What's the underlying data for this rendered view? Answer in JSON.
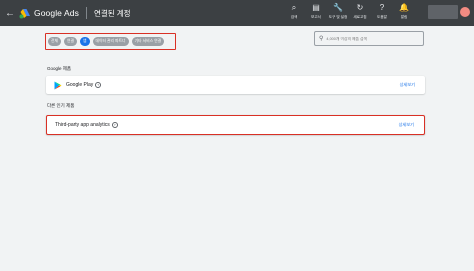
{
  "header": {
    "app_name": "Google Ads",
    "page_title": "연결된 계정",
    "tools": [
      {
        "icon": "search-icon",
        "glyph": "⌕",
        "label": "검색"
      },
      {
        "icon": "report-icon",
        "glyph": "▤",
        "label": "보고서"
      },
      {
        "icon": "wrench-icon",
        "glyph": "🔧",
        "label": "도구 및 설정"
      },
      {
        "icon": "refresh-icon",
        "glyph": "↻",
        "label": "새로고침"
      },
      {
        "icon": "help-icon",
        "glyph": "?",
        "label": "도움말"
      },
      {
        "icon": "bell-icon",
        "glyph": "🔔",
        "label": "알림"
      }
    ]
  },
  "filters": {
    "chips": [
      {
        "label": "전체",
        "active": false
      },
      {
        "label": "연결",
        "active": false
      },
      {
        "label": "앱",
        "active": true
      },
      {
        "label": "데이터 관리 파트너",
        "active": false
      },
      {
        "label": "기타 서비스 연결",
        "active": false
      }
    ]
  },
  "search": {
    "placeholder": "4,000개 이상의 제품 검색"
  },
  "google_section": {
    "label": "Google 제품",
    "items": [
      {
        "name": "Google Play",
        "detail": "상세보기"
      }
    ]
  },
  "other_section": {
    "label": "다른 인기 제품",
    "items": [
      {
        "name": "Third-party app analytics",
        "detail": "상세보기"
      }
    ]
  },
  "colors": {
    "accent": "#1a73e8",
    "highlight": "#d93025",
    "topbar": "#3c4043"
  }
}
